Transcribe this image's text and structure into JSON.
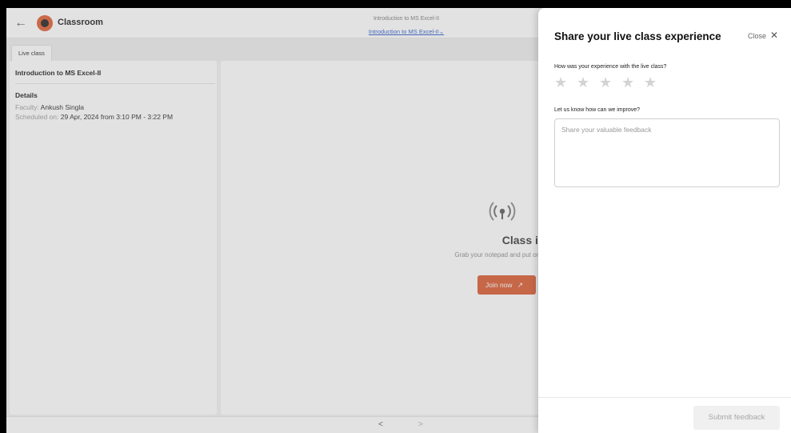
{
  "app": {
    "brand": "Classroom",
    "brand_color": "#e0582a",
    "back_icon": "arrow-left-icon",
    "breadcrumb": {
      "top": "Introduction to MS Excel-II",
      "link": "Introduction to MS Excel-II"
    },
    "tab_label": "Live class",
    "left_panel": {
      "title": "Introduction to MS Excel-II",
      "details_heading": "Details",
      "faculty_key": "Faculty:",
      "faculty_value": "Ankush Singla",
      "scheduled_key": "Scheduled on:",
      "scheduled_value": "29 Apr, 2024 from 3:10 PM - 3:22 PM"
    },
    "main": {
      "live_icon": "broadcast-icon",
      "title": "Class is now li",
      "subtitle": "Grab your notepad and put on your learning",
      "join_label": "Join now",
      "join_color": "#d8552a"
    },
    "pager": {
      "prev": "<",
      "next": ">"
    }
  },
  "drawer": {
    "title": "Share your live class experience",
    "close_label": "Close",
    "close_icon": "close-icon",
    "question_rating": "How was your experience with the live class?",
    "rating": {
      "value": 0,
      "max": 5
    },
    "question_improve": "Let us know how can we improve?",
    "feedback_placeholder": "Share your valuable feedback",
    "feedback_value": "",
    "submit_label": "Submit feedback"
  }
}
